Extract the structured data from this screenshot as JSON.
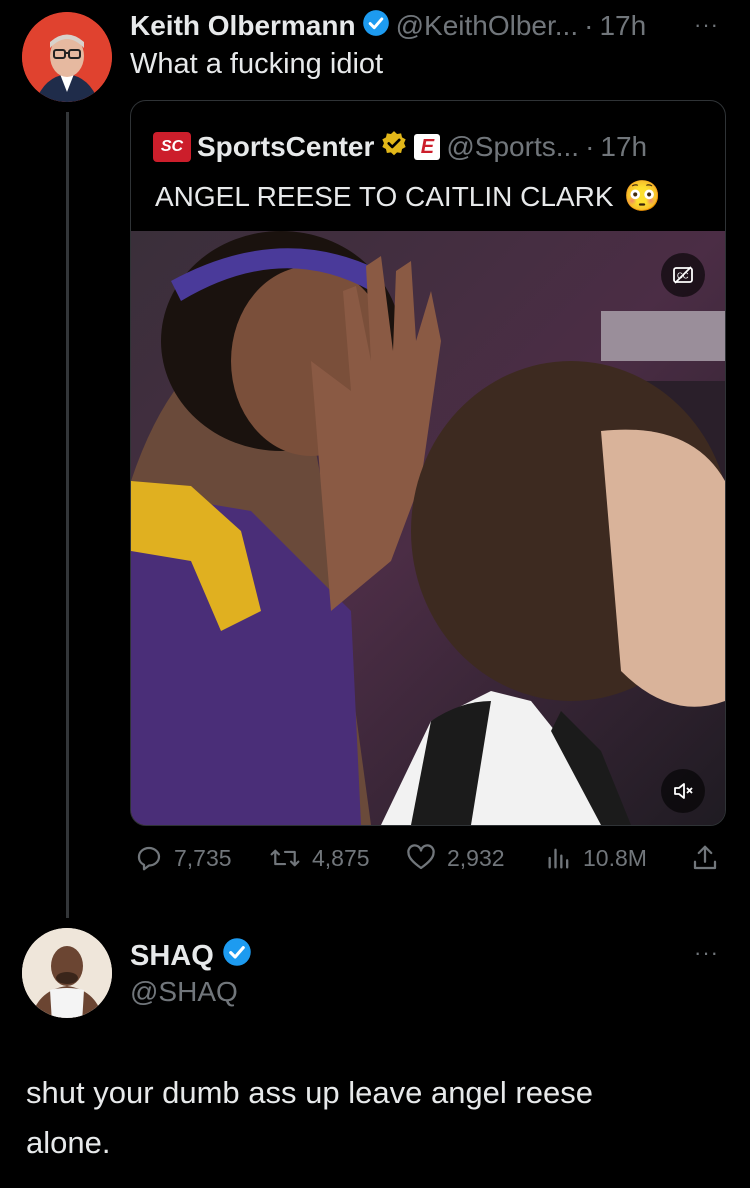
{
  "tweet1": {
    "display_name": "Keith Olbermann",
    "handle": "@KeithOlber...",
    "sep": "·",
    "time": "17h",
    "text": "What a fucking idiot"
  },
  "quote": {
    "display_name": "SportsCenter",
    "handle": "@Sports...",
    "sep": "·",
    "time": "17h",
    "text": "ANGEL REESE TO CAITLIN CLARK",
    "emoji": "😳",
    "logo_text": "SC",
    "badge_text": "E"
  },
  "actions": {
    "replies": "7,735",
    "reposts": "4,875",
    "likes": "2,932",
    "views": "10.8M"
  },
  "tweet2": {
    "display_name": "SHAQ",
    "handle": "@SHAQ",
    "text": "shut your dumb ass up leave angel reese alone."
  },
  "more_label": "···",
  "colors": {
    "background": "#000000",
    "text": "#e7e9ea",
    "muted": "#71767b",
    "verified_blue": "#1d9bf0",
    "verified_gold": "#e2b719",
    "espn_red": "#cc1e2b"
  }
}
